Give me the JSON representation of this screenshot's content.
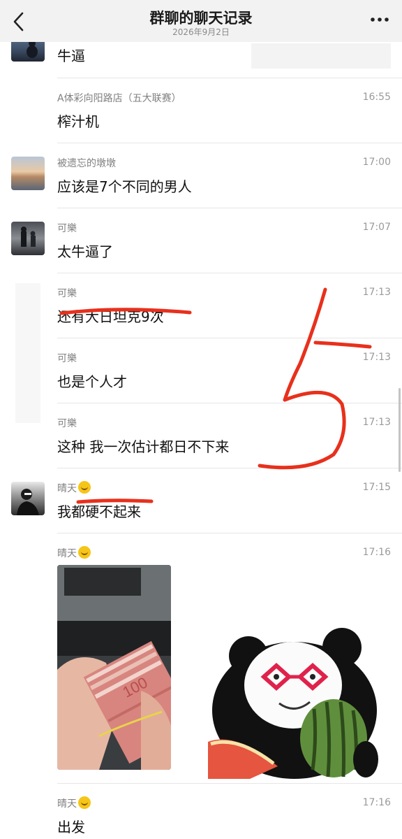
{
  "header": {
    "title": "群聊的聊天记录",
    "date": "2026年9月2日"
  },
  "messages": [
    {
      "sender": "",
      "time": "",
      "text": "牛逼"
    },
    {
      "sender": "A体彩向阳路店（五大联赛）",
      "time": "16:55",
      "text": "榨汁机"
    },
    {
      "sender": "被遗忘的墩墩",
      "time": "17:00",
      "text": "应该是7个不同的男人"
    },
    {
      "sender": "可樂",
      "time": "17:07",
      "text": "太牛逼了"
    },
    {
      "sender": "可樂",
      "time": "17:13",
      "text": "还有大日坦克9次"
    },
    {
      "sender": "可樂",
      "time": "17:13",
      "text": "也是个人才"
    },
    {
      "sender": "可樂",
      "time": "17:13",
      "text": "这种 我一次估计都日不下来"
    },
    {
      "sender": "晴天",
      "time": "17:15",
      "text": "我都硬不起来"
    },
    {
      "sender": "晴天",
      "time": "17:16",
      "text": ""
    },
    {
      "sender": "晴天",
      "time": "17:16",
      "text": "出发"
    }
  ],
  "annotation": {
    "text": "5",
    "color": "#e8301c"
  },
  "icons": {
    "back": "chevron-left-icon",
    "more": "more-dots-icon",
    "emoji": "smile-emoji-icon"
  },
  "colors": {
    "background": "#ffffff",
    "header": "#f2f2f2",
    "text": "#111111",
    "meta": "#808080",
    "scribble": "#e8301c"
  }
}
